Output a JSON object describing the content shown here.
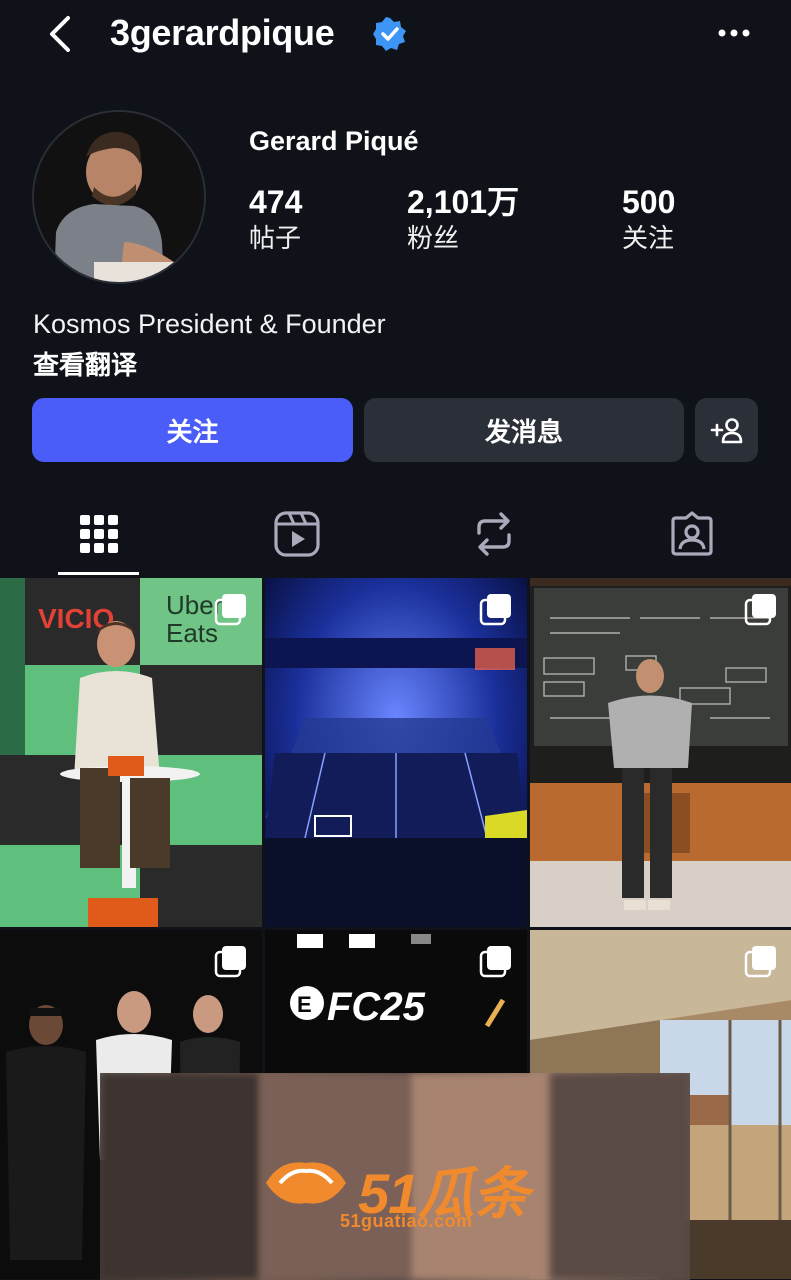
{
  "header": {
    "back_icon": "chevron-left-icon",
    "username": "3gerardpique",
    "verified_icon": "verified-badge-icon",
    "more_icon": "more-horizontal-icon"
  },
  "profile": {
    "display_name": "Gerard Piqué",
    "stats": {
      "posts_count": "474",
      "posts_label": "帖子",
      "followers_count": "2,101万",
      "followers_label": "粉丝",
      "following_count": "500",
      "following_label": "关注"
    },
    "bio": "Kosmos President & Founder",
    "translate_label": "查看翻译"
  },
  "actions": {
    "follow_label": "关注",
    "message_label": "发消息",
    "add_person_icon": "add-person-icon"
  },
  "tabs": [
    {
      "icon": "grid-icon",
      "active": true
    },
    {
      "icon": "reels-icon",
      "active": false
    },
    {
      "icon": "reposts-icon",
      "active": false
    },
    {
      "icon": "tagged-icon",
      "active": false
    }
  ],
  "grid_posts": [
    {
      "sign_texts": [
        "VICIO",
        "Uber",
        "Eats"
      ]
    },
    {
      "description_text": ""
    },
    {
      "description_text": ""
    },
    {
      "description_text": ""
    },
    {
      "sign_text": "FC25"
    },
    {
      "description_text": ""
    }
  ],
  "watermark": {
    "title": "51瓜条",
    "url": "51guatiao.com"
  },
  "colors": {
    "background": "#0f1219",
    "follow_button": "#4a5df9",
    "secondary_button": "#2b2f38",
    "verified": "#3d96f5"
  }
}
